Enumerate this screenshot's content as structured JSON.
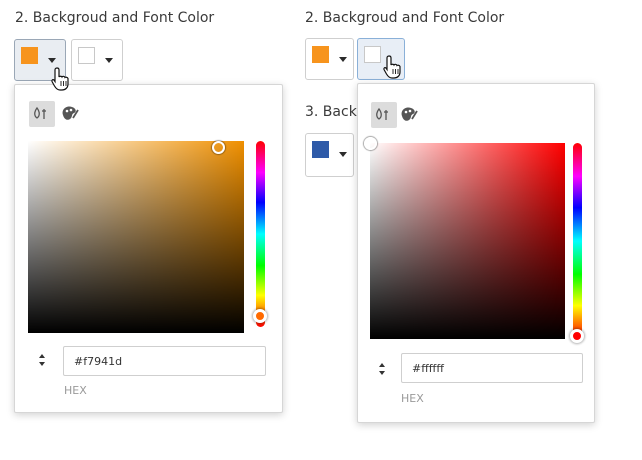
{
  "left_panel": {
    "section_title": "2. Backgroud and Font Color",
    "background_color": "#f7941d",
    "font_color": "#ffffff",
    "picker": {
      "hex_value": "#f7941d",
      "format_label": "HEX",
      "hue_color": "#f7941d",
      "sv_base": "#f09000"
    }
  },
  "right_panel": {
    "section_title": "2. Backgroud and Font Color",
    "next_section_title": "3. Backg",
    "background_color": "#f7941d",
    "font_color": "#ffffff",
    "next_swatch_color": "#2e5aa8",
    "picker": {
      "hex_value": "#ffffff",
      "format_label": "HEX",
      "hue_color": "#ff0000",
      "sv_base": "#ff0000"
    }
  },
  "icons": {
    "color_mode_sliders": "sliders-icon",
    "palette_mode": "palette-icon",
    "format_toggle": "up-down-arrows-icon",
    "pointer": "hand-pointer-icon",
    "dropdown": "caret-down-icon"
  }
}
